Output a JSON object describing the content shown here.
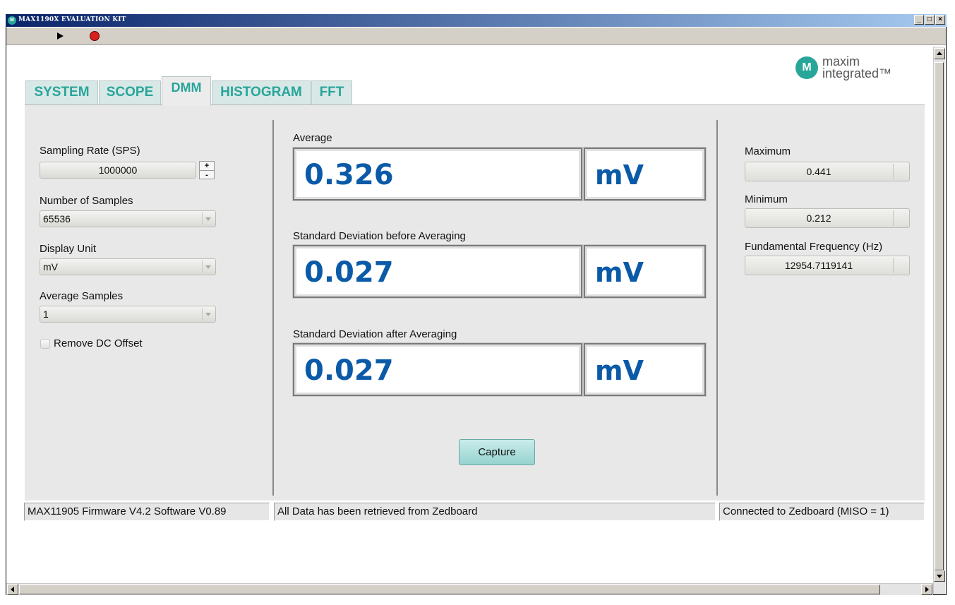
{
  "window": {
    "title": "MAX1190X EVALUATION KIT",
    "controls": [
      "_",
      "□",
      "×"
    ]
  },
  "toolbar": {
    "run_icon": "run-arrow-icon",
    "stop_icon": "stop-icon"
  },
  "logo": {
    "mark": "M",
    "line1": "maxim",
    "line2": "integrated™"
  },
  "tabs": [
    {
      "label": "SYSTEM",
      "active": false
    },
    {
      "label": "SCOPE",
      "active": false
    },
    {
      "label": "DMM",
      "active": true
    },
    {
      "label": "HISTOGRAM",
      "active": false
    },
    {
      "label": "FFT",
      "active": false
    }
  ],
  "settings": {
    "sampling_rate_label": "Sampling Rate (SPS)",
    "sampling_rate_value": "1000000",
    "spin_up": "+",
    "spin_down": "-",
    "samples_label": "Number of Samples",
    "samples_value": "65536",
    "display_unit_label": "Display Unit",
    "display_unit_value": "mV",
    "average_samples_label": "Average Samples",
    "average_samples_value": "1",
    "remove_dc_label": "Remove DC Offset",
    "remove_dc_checked": false
  },
  "measurements": {
    "average_label": "Average",
    "average_value": "0.326",
    "average_unit": "mV",
    "std_before_label": "Standard Deviation before Averaging",
    "std_before_value": "0.027",
    "std_before_unit": "mV",
    "std_after_label": "Standard Deviation after Averaging",
    "std_after_value": "0.027",
    "std_after_unit": "mV",
    "capture_label": "Capture"
  },
  "stats": {
    "maximum_label": "Maximum",
    "maximum_value": "0.441",
    "minimum_label": "Minimum",
    "minimum_value": "0.212",
    "fundamental_label": "Fundamental Frequency (Hz)",
    "fundamental_value": "12954.7119141"
  },
  "statusbar": {
    "version": "MAX11905 Firmware V4.2 Software V0.89",
    "message": "All Data has been retrieved from Zedboard",
    "connection": "Connected to Zedboard (MISO = 1)"
  },
  "colors": {
    "accent_teal": "#2aa59a",
    "value_blue": "#0a5aa8",
    "title_bar": "#0a246a"
  }
}
